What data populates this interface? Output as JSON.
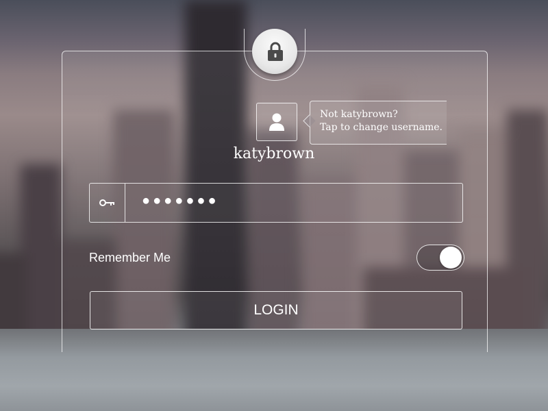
{
  "login": {
    "username": "katybrown",
    "tooltip_line1": "Not katybrown?",
    "tooltip_line2": "Tap to change username.",
    "password_mask": "●●●●●●●",
    "remember_label": "Remember Me",
    "remember_enabled": true,
    "login_label": "LOGIN"
  },
  "icons": {
    "lock": "lock-icon",
    "user": "user-icon",
    "key": "key-icon"
  },
  "colors": {
    "panel_border": "#ffffff",
    "lock_badge": "#eeeeee",
    "text": "#ffffff"
  }
}
